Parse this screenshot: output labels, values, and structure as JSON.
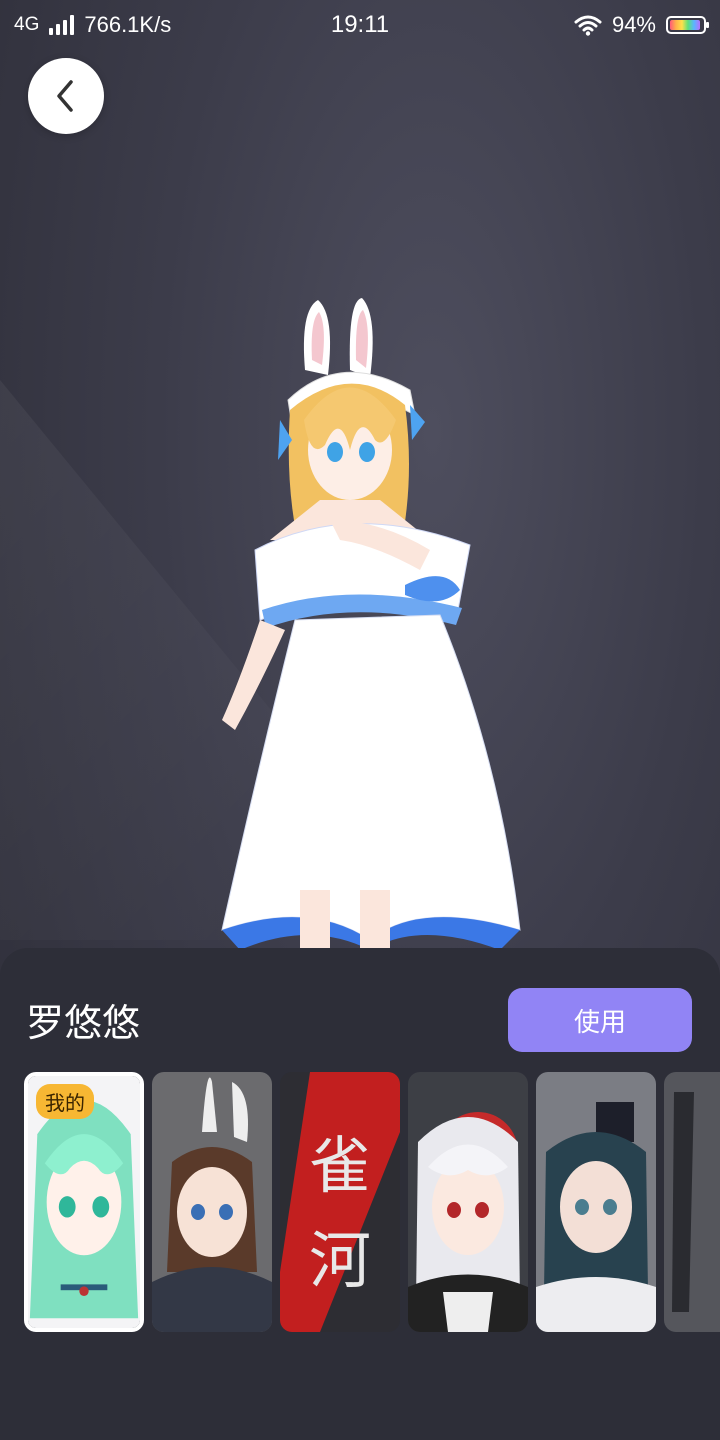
{
  "status_bar": {
    "network_type": "4G",
    "speed": "766.1K/s",
    "time": "19:11",
    "battery": "94%",
    "icons": [
      "signal-icon",
      "wifi-icon",
      "battery-icon"
    ]
  },
  "back_button": {
    "icon": "chevron-left-icon"
  },
  "panel": {
    "model_name": "罗悠悠",
    "use_button_label": "使用",
    "accent_color": "#9184f5",
    "thumbnails": [
      {
        "badge": "我的",
        "selected": true
      },
      {
        "selected": false
      },
      {
        "text": "雀河",
        "selected": false
      },
      {
        "selected": false
      },
      {
        "selected": false
      },
      {
        "selected": false
      }
    ]
  }
}
